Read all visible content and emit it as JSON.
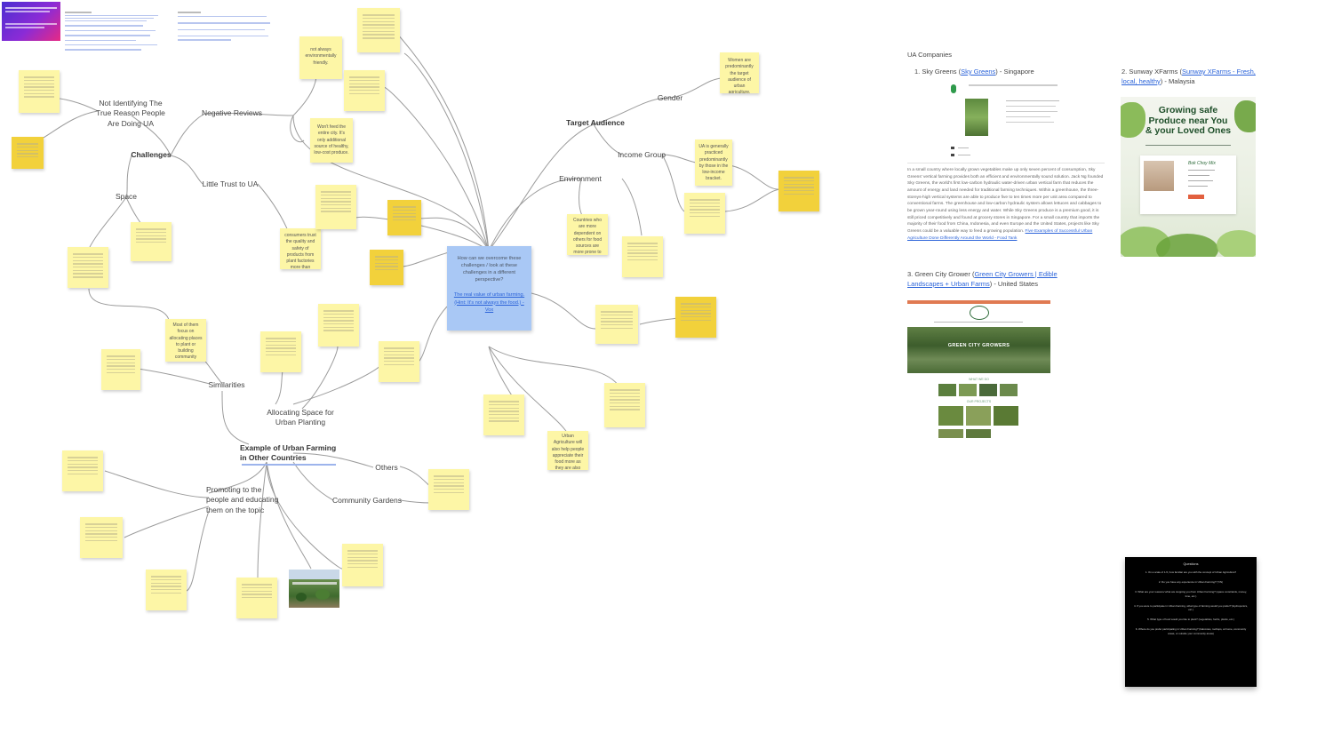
{
  "central": {
    "question": "How can we overcome these challenges / look at these challenges in a different perspective?",
    "link": "The real value of urban farming. (Hint: It's not always the food.) - Vox"
  },
  "nodes": {
    "challenges": "Challenges",
    "negative_reviews": "Negative Reviews",
    "not_identifying": "Not Identifying The True Reason People Are Doing UA",
    "little_trust": "Little Trust to UA",
    "space": "Space",
    "similarities": "Similarities",
    "allocating": "Allocating Space for Urban Planting",
    "example": "Example of Urban Farming in Other Countries",
    "others": "Others",
    "community_gardens": "Community Gardens",
    "promoting": "Promoting to the people and educating them on the topic",
    "target_audience": "Target Audience",
    "gender": "Gender",
    "income_group": "Income Group",
    "environment": "Environment"
  },
  "stickies": {
    "not_always": "not always environmentally friendly.",
    "wont_feed": "Won't feed the entire city. It's only additional source of healthy, low-cost produce.",
    "most_of_them": "Most of them focus on allocating places to plant or building community space for UA. A lot of plans do not cater to individual planting.",
    "women": "Women are predominantly the target audience of urban agriculture.",
    "ua_generally": "UA is generally practiced predominantly by those in the low-income bracket.",
    "urban_agri": "Urban Agriculture will also help people appreciate their food more as they are also planting themselves.",
    "countries": "Countries who are more dependent on others for food sources are more prone to take part in urban agriculture.",
    "consumers": "consumers trust the quality and safety of products from plant factories more than conventional agri businesses.",
    "pros": "Pros: It will allow communities to get to know each other"
  },
  "ua_companies": {
    "heading": "UA Companies",
    "c1": {
      "prefix": "1. Sky Greens (",
      "link": "Sky Greens",
      "suffix": ") - Singapore",
      "paragraph": "In a small country where locally grown vegetables make up only seven percent of consumption, Sky Greens' vertical farming provides both an efficient and environmentally sound solution. Jack Ng founded Sky Greens, the world's first low-carbon hydraulic water-driven urban vertical farm that reduces the amount of energy and land needed for traditional farming techniques. Within a greenhouse, the three-storeys-high vertical systems are able to produce five to ten times more per unit area compared to conventional farms. The greenhouse and low-carbon hydraulic system allows lettuces and cabbages to be grown year-round using less energy and water. While Sky Greens produce is a premium good, it is still priced competitively and found at grocery stores in Singapore. For a small country that imports the majority of their food from China, Indonesia, and even Europe and the United States, projects like Sky Greens could be a valuable way to feed a growing population.",
      "source": "Five Examples of Successful Urban Agriculture Done Differently Around the World - Food Tank"
    },
    "c2": {
      "prefix": "2. Sunway XFarms (",
      "link": "Sunway XFarms - Fresh, local, healthy",
      "suffix": ") - Malaysia",
      "banner_line1": "Growing safe",
      "banner_line2": "Produce near You",
      "banner_line3": "& your Loved Ones",
      "card_title": "Bok Choy Mix"
    },
    "c3": {
      "prefix": "3. Green City Grower (",
      "link": "Green City Growers | Edible Landscapes + Urban Farms",
      "suffix": ") - United States",
      "hero_text": "GREEN CITY GROWERS",
      "sub1": "WHAT WE DO",
      "sub2": "OUR PROJECTS"
    }
  },
  "questions_card": {
    "title": "Questions",
    "items": [
      "1. On a scale of 1-5, how familiar are you with the concept of Urban Agriculture?",
      "2. Do you have any experience in Urban Farming? (Y/N)",
      "3. What are your reasons/ what are stopping you from Urban Farming? (space constraints, money, time, etc.)",
      "4. If you were to participate in Urban Farming, what type of farming would you prefer? (Hydroponics, etc.)",
      "5. What type of food would you like to plant? (vegetables, herbs, plants, etc.)",
      "6. Where do you prefer participating in Urban Farming? (balconies, rooftops, at home, community areas, or outside your community areas)"
    ]
  },
  "colors": {
    "sticky": "#fdf6a6",
    "sticky_dark": "#f2d13b",
    "central": "#a9c8f5",
    "link": "#2b63d9",
    "connector": "#9a9a9a"
  }
}
